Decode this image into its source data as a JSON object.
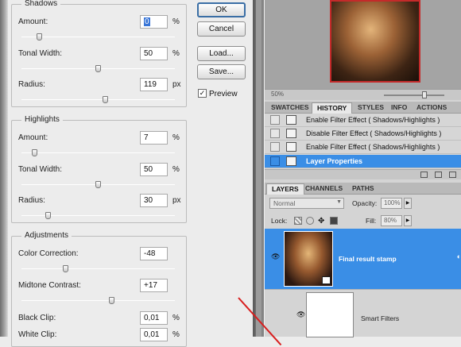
{
  "dialog": {
    "shadows": {
      "title": "Shadows",
      "amount_label": "Amount:",
      "amount_value": "0",
      "amount_unit": "%",
      "amount_level": 0.1,
      "tonal_label": "Tonal Width:",
      "tonal_value": "50",
      "tonal_unit": "%",
      "tonal_level": 0.5,
      "radius_label": "Radius:",
      "radius_value": "119",
      "radius_unit": "px",
      "radius_level": 0.55
    },
    "highlights": {
      "title": "Highlights",
      "amount_label": "Amount:",
      "amount_value": "7",
      "amount_unit": "%",
      "amount_level": 0.07,
      "tonal_label": "Tonal Width:",
      "tonal_value": "50",
      "tonal_unit": "%",
      "tonal_level": 0.5,
      "radius_label": "Radius:",
      "radius_value": "30",
      "radius_unit": "px",
      "radius_level": 0.16
    },
    "adjustments": {
      "title": "Adjustments",
      "color_label": "Color Correction:",
      "color_value": "-48",
      "color_level": 0.28,
      "midtone_label": "Midtone Contrast:",
      "midtone_value": "+17",
      "midtone_level": 0.59,
      "black_label": "Black Clip:",
      "black_value": "0,01",
      "black_unit": "%",
      "white_label": "White Clip:",
      "white_value": "0,01",
      "white_unit": "%"
    },
    "buttons": {
      "ok": "OK",
      "cancel": "Cancel",
      "load": "Load...",
      "save": "Save..."
    },
    "preview": {
      "label": "Preview",
      "checked": true
    }
  },
  "navigator": {
    "zoom": "50%"
  },
  "panel_tabs": [
    "SWATCHES",
    "HISTORY",
    "STYLES",
    "INFO",
    "ACTIONS"
  ],
  "history": [
    {
      "label": "Enable Filter Effect ( Shadows/Highlights )",
      "selected": false
    },
    {
      "label": "Disable Filter Effect ( Shadows/Highlights )",
      "selected": false
    },
    {
      "label": "Enable Filter Effect ( Shadows/Highlights )",
      "selected": false
    },
    {
      "label": "Layer Properties",
      "selected": true
    }
  ],
  "layer_tabs": [
    "LAYERS",
    "CHANNELS",
    "PATHS"
  ],
  "layers_panel": {
    "blend_mode": "Normal",
    "opacity_label": "Opacity:",
    "opacity_value": "100%",
    "lock_label": "Lock:",
    "fill_label": "Fill:",
    "fill_value": "80%",
    "layer_name": "Final result stamp",
    "smart_filters": "Smart Filters"
  },
  "colors": {
    "selection": "#3a8ee6",
    "annotation_arrow": "#d81e1e"
  }
}
